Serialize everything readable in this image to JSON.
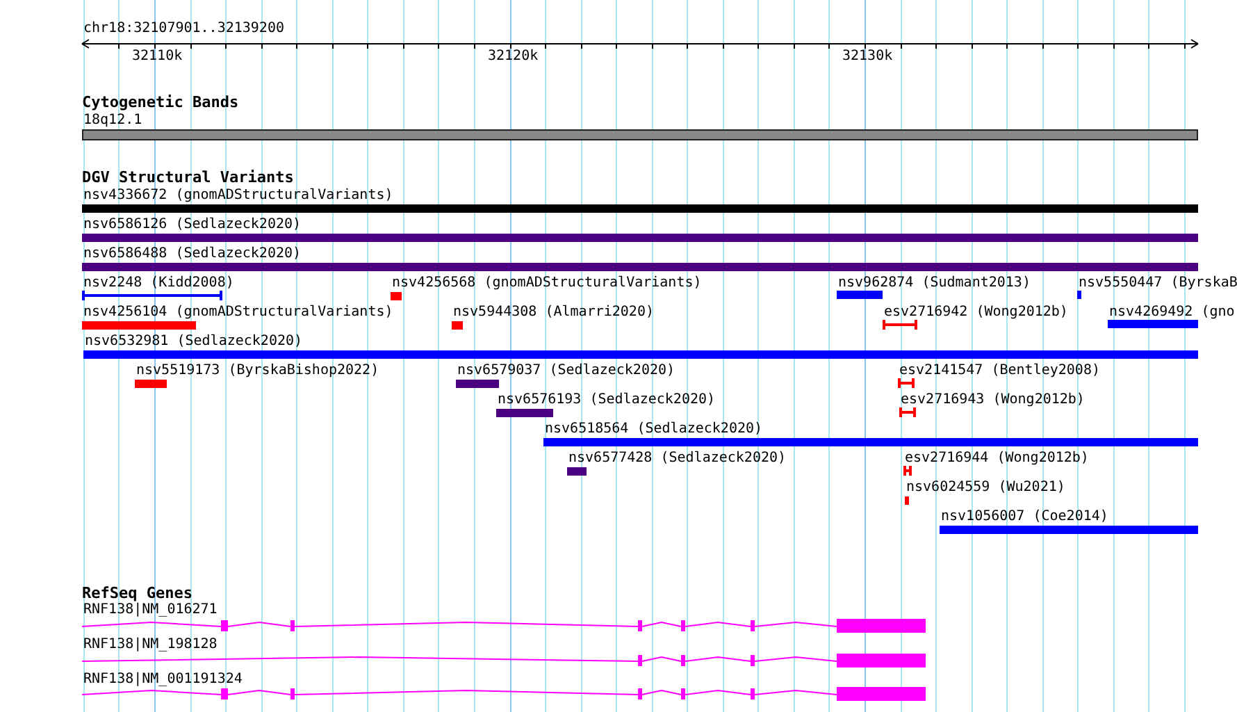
{
  "ruler": {
    "location": "chr18:32107901..32139200",
    "ticks": [
      "32110k",
      "32120k",
      "32130k"
    ]
  },
  "cytogenetic_bands": {
    "title": "Cytogenetic Bands",
    "band": "18q12.1"
  },
  "dgv_structural_variants": {
    "title": "DGV Structural Variants",
    "features": [
      {
        "label": "nsv4336672 (gnomADStructuralVariants)",
        "kind": "bar",
        "color": "#000000"
      },
      {
        "label": "nsv6586126 (Sedlazeck2020)",
        "kind": "bar",
        "color": "#4b0082"
      },
      {
        "label": "nsv6586488 (Sedlazeck2020)",
        "kind": "bar",
        "color": "#4b0082"
      },
      {
        "label": "nsv2248 (Kidd2008)",
        "kind": "span",
        "color": "#0000ff"
      },
      {
        "label": "nsv4256568 (gnomADStructuralVariants)",
        "kind": "bar",
        "color": "#ff0000"
      },
      {
        "label": "nsv962874 (Sudmant2013)",
        "kind": "bar",
        "color": "#0000ff"
      },
      {
        "label": "nsv5550447 (ByrskaB",
        "kind": "bar",
        "color": "#0000ff"
      },
      {
        "label": "nsv4256104 (gnomADStructuralVariants)",
        "kind": "bar",
        "color": "#ff0000"
      },
      {
        "label": "nsv5944308 (Almarri2020)",
        "kind": "bar",
        "color": "#ff0000"
      },
      {
        "label": "esv2716942 (Wong2012b)",
        "kind": "span",
        "color": "#ff0000"
      },
      {
        "label": "nsv4269492 (gno",
        "kind": "bar",
        "color": "#0000ff"
      },
      {
        "label": "nsv6532981 (Sedlazeck2020)",
        "kind": "bar",
        "color": "#0000ff"
      },
      {
        "label": "nsv5519173 (ByrskaBishop2022)",
        "kind": "bar",
        "color": "#ff0000"
      },
      {
        "label": "nsv6579037 (Sedlazeck2020)",
        "kind": "bar",
        "color": "#4b0082"
      },
      {
        "label": "esv2141547 (Bentley2008)",
        "kind": "span",
        "color": "#ff0000"
      },
      {
        "label": "nsv6576193 (Sedlazeck2020)",
        "kind": "bar",
        "color": "#4b0082"
      },
      {
        "label": "esv2716943 (Wong2012b)",
        "kind": "span",
        "color": "#ff0000"
      },
      {
        "label": "nsv6518564 (Sedlazeck2020)",
        "kind": "bar",
        "color": "#0000ff"
      },
      {
        "label": "nsv6577428 (Sedlazeck2020)",
        "kind": "bar",
        "color": "#4b0082"
      },
      {
        "label": "esv2716944 (Wong2012b)",
        "kind": "span",
        "color": "#ff0000"
      },
      {
        "label": "nsv6024559 (Wu2021)",
        "kind": "bar",
        "color": "#ff0000"
      },
      {
        "label": "nsv1056007 (Coe2014)",
        "kind": "bar",
        "color": "#0000ff"
      }
    ]
  },
  "refseq_genes": {
    "title": "RefSeq Genes",
    "genes": [
      {
        "label": "RNF138|NM_016271"
      },
      {
        "label": "RNF138|NM_198128"
      },
      {
        "label": "RNF138|NM_001191324"
      }
    ]
  }
}
